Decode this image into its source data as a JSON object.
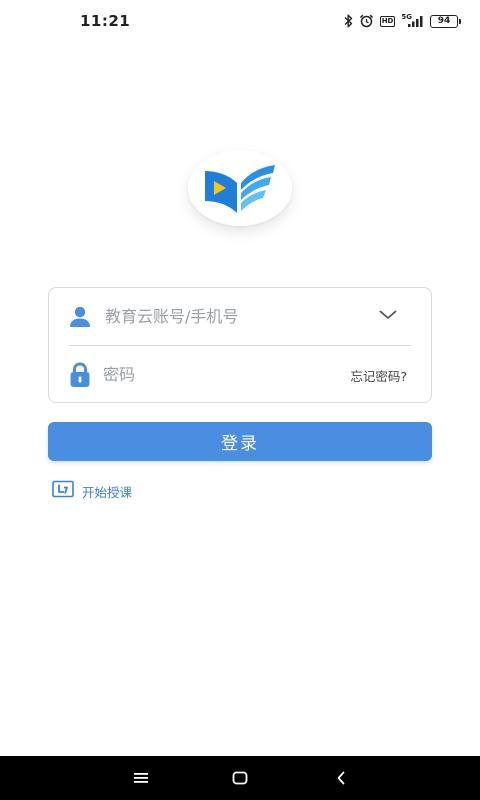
{
  "status_bar": {
    "time": "11:21",
    "network_label": "5G",
    "hd_label": "HD",
    "battery_level": "94",
    "icons": [
      "bluetooth-icon",
      "alarm-icon",
      "hd-icon",
      "signal-icon",
      "battery-icon"
    ]
  },
  "app": {
    "logo_icon": "book-play-logo",
    "brand_colors": {
      "primary": "#4a8ee2",
      "logo_dark": "#1f7fd8",
      "logo_light": "#5fc2f2",
      "logo_play": "#f5c518"
    }
  },
  "login_form": {
    "account": {
      "placeholder": "教育云账号/手机号",
      "value": "",
      "icon": "user-icon",
      "dropdown_icon": "chevron-down-icon"
    },
    "password": {
      "placeholder": "密码",
      "value": "",
      "icon": "lock-icon",
      "forgot_label": "忘记密码?"
    },
    "login_button_label": "登录"
  },
  "start_teaching": {
    "label": "开始授课",
    "icon": "teaching-icon"
  },
  "nav_bar": {
    "buttons": [
      "menu-icon",
      "home-icon",
      "back-icon"
    ]
  }
}
